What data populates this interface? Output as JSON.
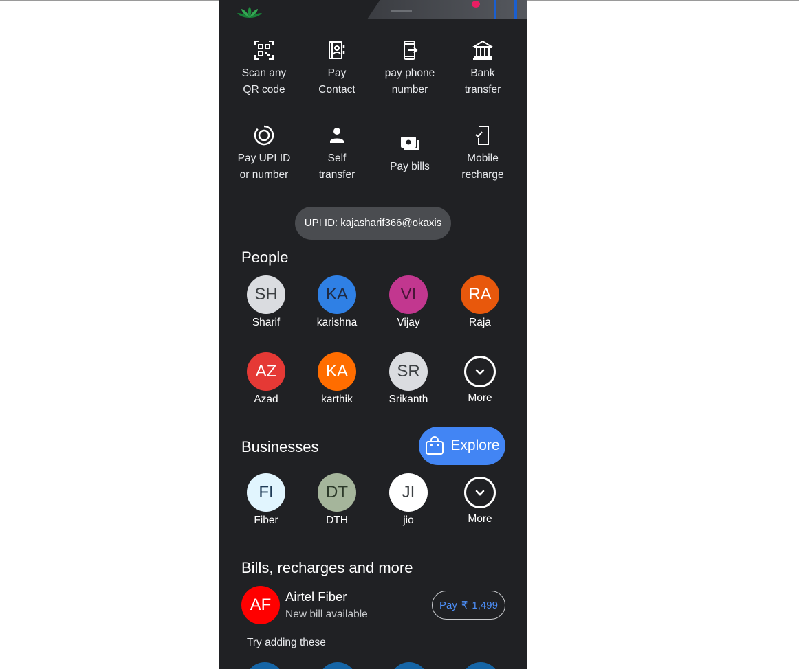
{
  "actions": [
    {
      "label": "Scan any\nQR code",
      "icon": "qr-scan-icon"
    },
    {
      "label": "Pay\nContact",
      "icon": "contact-book-icon"
    },
    {
      "label": "pay phone\nnumber",
      "icon": "phone-transfer-icon"
    },
    {
      "label": "Bank\ntransfer",
      "icon": "bank-icon"
    },
    {
      "label": "Pay UPI ID\nor number",
      "icon": "upi-target-icon"
    },
    {
      "label": "Self\ntransfer",
      "icon": "person-icon"
    },
    {
      "label": "Pay bills",
      "icon": "bills-icon"
    },
    {
      "label": "Mobile\nrecharge",
      "icon": "mobile-recharge-icon"
    }
  ],
  "upi": {
    "text": "UPI ID: kajasharif366@okaxis"
  },
  "people": {
    "title": "People",
    "contacts": [
      {
        "initials": "SH",
        "name": "Sharif",
        "color": "#dadce0",
        "text_color": "#3c4043"
      },
      {
        "initials": "KA",
        "name": "karishna",
        "color": "#2f80e5",
        "text_color": "#1f2a44"
      },
      {
        "initials": "VI",
        "name": "Vijay",
        "color": "#c2378f",
        "text_color": "#4a1538"
      },
      {
        "initials": "RA",
        "name": "Raja",
        "color": "#e8580c",
        "text_color": "#ffffff"
      },
      {
        "initials": "AZ",
        "name": "Azad",
        "color": "#e53935",
        "text_color": "#ffffff"
      },
      {
        "initials": "KA",
        "name": "karthik",
        "color": "#ff6d00",
        "text_color": "#ffffff"
      },
      {
        "initials": "SR",
        "name": "Srikanth",
        "color": "#dadce0",
        "text_color": "#3c4043"
      }
    ],
    "more_label": "More"
  },
  "businesses": {
    "title": "Businesses",
    "explore_label": "Explore",
    "items": [
      {
        "initials": "FI",
        "name": "Fiber",
        "color": "#e1f5fe",
        "text_color": "#1f3b57"
      },
      {
        "initials": "DT",
        "name": "DTH",
        "color": "#a5b59b",
        "text_color": "#2d3a2a"
      },
      {
        "initials": "JI",
        "name": "jio",
        "color": "#ffffff",
        "text_color": "#3c4043"
      }
    ],
    "more_label": "More"
  },
  "bills": {
    "title": "Bills, recharges and more",
    "item": {
      "initials": "AF",
      "name": "Airtel Fiber",
      "status": "New bill available",
      "pay_label": "Pay",
      "currency": "₹",
      "amount": "1,499"
    },
    "try_text": "Try adding these"
  }
}
